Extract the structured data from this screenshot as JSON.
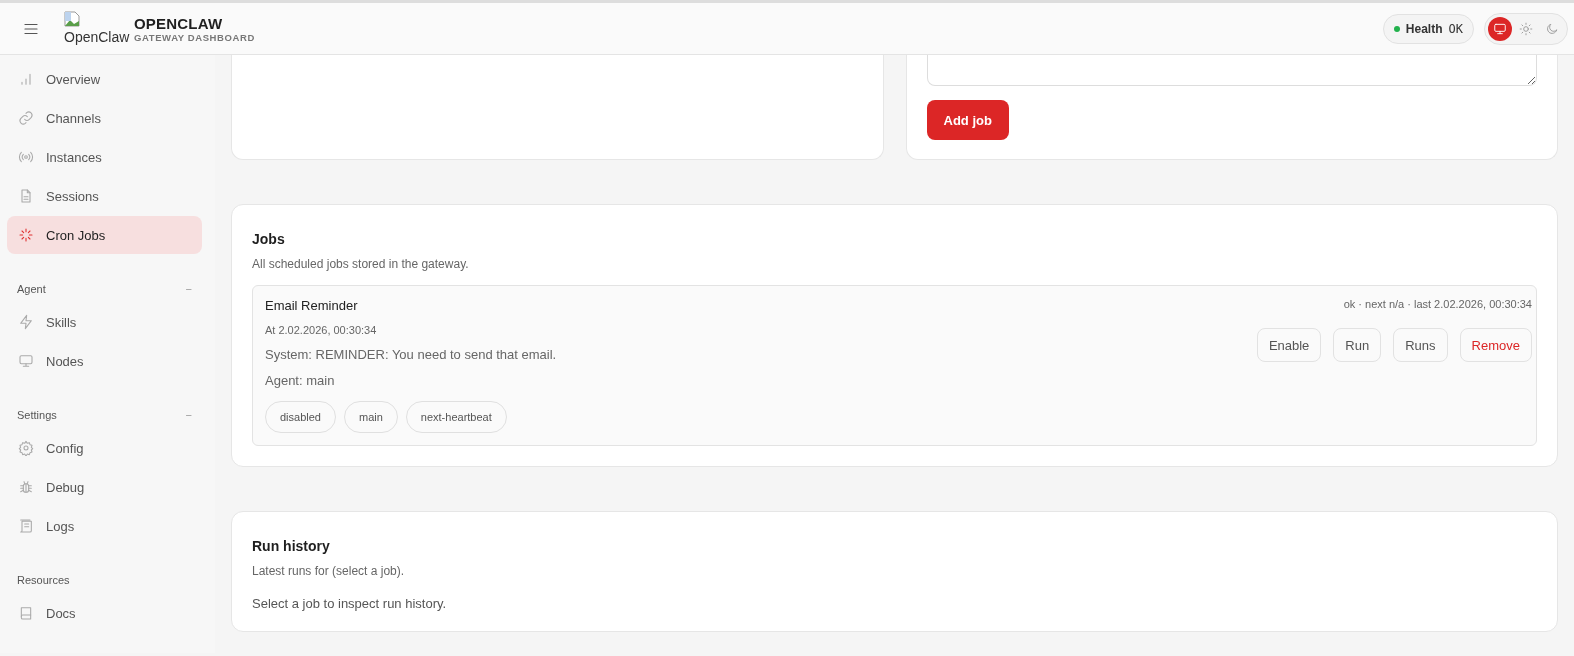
{
  "header": {
    "logo_alt": "OpenClaw",
    "title": "OPENCLAW",
    "subtitle": "GATEWAY DASHBOARD",
    "health": {
      "label": "Health",
      "value": "OK",
      "ok": true
    },
    "theme_options": [
      {
        "kind": "system",
        "selected": true
      },
      {
        "kind": "light",
        "selected": false
      },
      {
        "kind": "dark",
        "selected": false
      }
    ]
  },
  "sidebar": {
    "groups": [
      {
        "items": [
          {
            "kind": "chart",
            "label": "Overview",
            "selected": false
          },
          {
            "kind": "link",
            "label": "Channels",
            "selected": false
          },
          {
            "kind": "radio",
            "label": "Instances",
            "selected": false
          },
          {
            "kind": "file",
            "label": "Sessions",
            "selected": false
          },
          {
            "kind": "spark",
            "label": "Cron Jobs",
            "selected": true
          }
        ]
      },
      {
        "label": "Agent",
        "collapse": "−",
        "items": [
          {
            "kind": "bolt",
            "label": "Skills",
            "selected": false
          },
          {
            "kind": "monitor",
            "label": "Nodes",
            "selected": false
          }
        ]
      },
      {
        "label": "Settings",
        "collapse": "−",
        "items": [
          {
            "kind": "gear",
            "label": "Config",
            "selected": false
          },
          {
            "kind": "bug",
            "label": "Debug",
            "selected": false
          },
          {
            "kind": "scroll",
            "label": "Logs",
            "selected": false
          }
        ]
      },
      {
        "label": "Resources",
        "items": [
          {
            "kind": "book",
            "label": "Docs",
            "selected": false
          }
        ]
      }
    ]
  },
  "form": {
    "add_button": "Add job"
  },
  "jobs": {
    "title": "Jobs",
    "subtitle": "All scheduled jobs stored in the gateway.",
    "items": [
      {
        "name": "Email Reminder",
        "schedule": "At 2.02.2026, 00:30:34",
        "prompt": "System: REMINDER: You need to send that email.",
        "agent": "Agent: main",
        "tags": [
          "disabled",
          "main",
          "next-heartbeat"
        ],
        "status": "ok · next n/a · last 2.02.2026, 00:30:34",
        "actions": [
          {
            "label": "Enable",
            "kind": "normal"
          },
          {
            "label": "Run",
            "kind": "normal"
          },
          {
            "label": "Runs",
            "kind": "normal"
          },
          {
            "label": "Remove",
            "kind": "danger"
          }
        ]
      }
    ]
  },
  "run_history": {
    "title": "Run history",
    "subtitle": "Latest runs for (select a job).",
    "empty": "Select a job to inspect run history."
  }
}
